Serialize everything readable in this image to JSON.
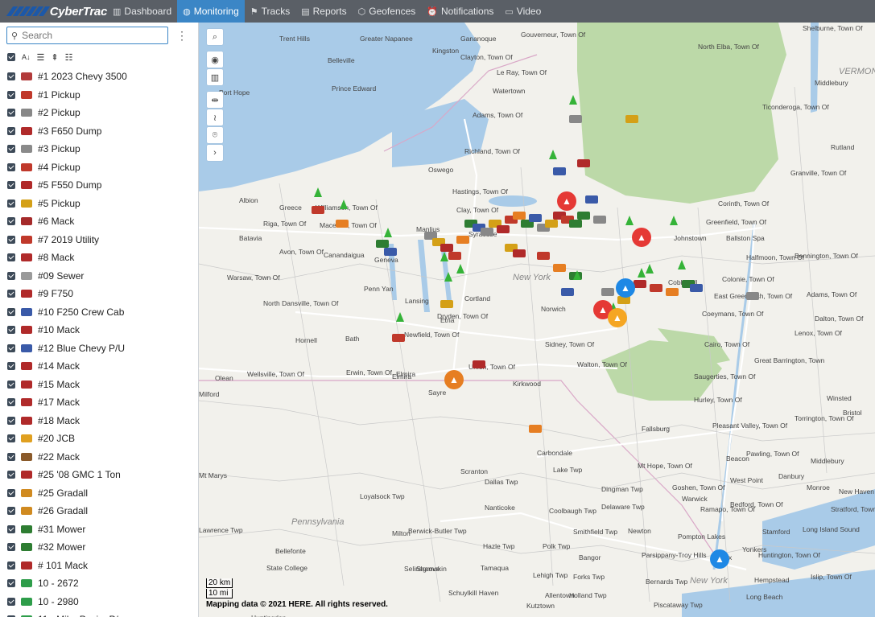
{
  "app": {
    "brand": "CyberTrac",
    "nav": [
      {
        "label": "Dashboard",
        "icon": "bar-chart-icon",
        "active": false
      },
      {
        "label": "Monitoring",
        "icon": "globe-icon",
        "active": true
      },
      {
        "label": "Tracks",
        "icon": "flag-icon",
        "active": false
      },
      {
        "label": "Reports",
        "icon": "report-icon",
        "active": false
      },
      {
        "label": "Geofences",
        "icon": "geofence-icon",
        "active": false
      },
      {
        "label": "Notifications",
        "icon": "alarm-clock-icon",
        "active": false
      },
      {
        "label": "Video",
        "icon": "video-icon",
        "active": false
      }
    ]
  },
  "sidebar": {
    "search_placeholder": "Search",
    "vehicles": [
      {
        "label": "#1 2023 Chevy 3500",
        "color": "#b23b3b"
      },
      {
        "label": "#1 Pickup",
        "color": "#c0392b"
      },
      {
        "label": "#2 Pickup",
        "color": "#888888"
      },
      {
        "label": "#3 F650 Dump",
        "color": "#b02a2a"
      },
      {
        "label": "#3 Pickup",
        "color": "#8a8a8a"
      },
      {
        "label": "#4 Pickup",
        "color": "#c0392b"
      },
      {
        "label": "#5 F550 Dump",
        "color": "#b02a2a"
      },
      {
        "label": "#5 Pickup",
        "color": "#d4a017"
      },
      {
        "label": "#6 Mack",
        "color": "#a52a2a"
      },
      {
        "label": "#7 2019 Utility",
        "color": "#c0392b"
      },
      {
        "label": "#8 Mack",
        "color": "#b02a2a"
      },
      {
        "label": "#09 Sewer",
        "color": "#9a9a9a"
      },
      {
        "label": "#9 F750",
        "color": "#b02a2a"
      },
      {
        "label": "#10 F250 Crew Cab",
        "color": "#3a5aa8"
      },
      {
        "label": "#10 Mack",
        "color": "#b02a2a"
      },
      {
        "label": "#12 Blue Chevy P/U",
        "color": "#3a5aa8"
      },
      {
        "label": "#14 Mack",
        "color": "#b02a2a"
      },
      {
        "label": "#15 Mack",
        "color": "#b02a2a"
      },
      {
        "label": "#17 Mack",
        "color": "#b02a2a"
      },
      {
        "label": "#18 Mack",
        "color": "#b02a2a"
      },
      {
        "label": "#20 JCB",
        "color": "#e0a020"
      },
      {
        "label": "#22 Mack",
        "color": "#8a5a2a"
      },
      {
        "label": "#25 '08 GMC 1 Ton",
        "color": "#b02a2a"
      },
      {
        "label": "#25 Gradall",
        "color": "#d08a20"
      },
      {
        "label": "#26 Gradall",
        "color": "#d08a20"
      },
      {
        "label": "#31 Mower",
        "color": "#2e7d32"
      },
      {
        "label": "#32 Mower",
        "color": "#2e7d32"
      },
      {
        "label": "# 101 Mack",
        "color": "#b02a2a"
      },
      {
        "label": "10 - 2672",
        "color": "#2e9d4a"
      },
      {
        "label": "10 - 2980",
        "color": "#2e9d4a"
      },
      {
        "label": "11 - Mike Pesi... P/u",
        "color": "#2e9d4a"
      }
    ]
  },
  "map": {
    "scale_km": "20 km",
    "scale_mi": "10 mi",
    "credit": "Mapping data © 2021 HERE. All rights reserved.",
    "labels": [
      "Trent Hills",
      "Greater Napanee",
      "Gananoque",
      "Gouverneur, Town Of",
      "Shelburne, Town Of",
      "North Elba, Town Of",
      "Kingston",
      "Clayton, Town Of",
      "Belleville",
      "Middlebury",
      "VERMONT",
      "Le Ray, Town Of",
      "Prince Edward",
      "Port Hope",
      "Watertown",
      "Ticonderoga, Town Of",
      "Adams, Town Of",
      "Richland, Town Of",
      "Rutland",
      "Oswego",
      "Granville, Town Of",
      "Hastings, Town Of",
      "Albion",
      "Williamson, Town Of",
      "Clay, Town Of",
      "Corinth, Town Of",
      "Riga, Town Of",
      "Macedon, Town Of",
      "Greenfield, Town Of",
      "Batavia",
      "Syracuse",
      "Johnstown",
      "Ballston Spa",
      "Avon, Town Of",
      "Canandaigua",
      "Geneva",
      "Halfmoon, Town Of",
      "Bennington, Town Of",
      "Warsaw, Town Of",
      "New York",
      "Cobleskill",
      "Colonie, Town Of",
      "Penn Yan",
      "North Dansville, Town Of",
      "Lansing",
      "Cortland",
      "Norwich",
      "East Greenbush, Town Of",
      "Adams, Town Of",
      "Coeymans, Town Of",
      "Dryden, Town Of",
      "Dalton, Town Of",
      "Hornell",
      "Bath",
      "Newfield, Town Of",
      "Lenox, Town Of",
      "Sidney, Town Of",
      "Cairo, Town Of",
      "Erwin, Town Of",
      "Elmira",
      "Union, Town Of",
      "Walton, Town Of",
      "Great Barrington, Town",
      "Olean",
      "Wellsville, Town Of",
      "Saugerties, Town Of",
      "Sayre",
      "Kirkwood",
      "Hurley, Town Of",
      "Winsted",
      "Pleasant Valley, Town Of",
      "Torrington, Town Of",
      "Bristol",
      "Fallsburg",
      "Carbondale",
      "Pawling, Town Of",
      "Middlebury",
      "Scranton",
      "Mt Hope, Town Of",
      "Beacon",
      "Lake Twp",
      "Dallas Twp",
      "Dingman Twp",
      "Goshen, Town Of",
      "West Point",
      "Danbury",
      "Monroe",
      "New Haven",
      "Loyalsock Twp",
      "Delaware Twp",
      "Warwick",
      "Bedford, Town Of",
      "Stratford, Town Of",
      "Nanticoke",
      "Coolbaugh Twp",
      "Ramapo, Town Of",
      "Pennsylvania",
      "Berwick-Butler Twp",
      "Smithfield Twp",
      "Newton",
      "Stamford",
      "Long Island Sound",
      "Milton",
      "Pompton Lakes",
      "Yonkers",
      "Hazle Twp",
      "Polk Twp",
      "Bangor",
      "Parsippany-Troy Hills",
      "Huntington, Town Of",
      "Bellefonte",
      "State College",
      "Tamaqua",
      "Lehigh Twp",
      "Forks Twp",
      "Selinsgrove",
      "Shamokin",
      "Bronx",
      "New York",
      "Hempstead",
      "Islip, Town Of",
      "Schuylkill Haven",
      "Allentown",
      "Holland Twp",
      "Bernards Twp",
      "Kutztown",
      "Piscataway Twp",
      "Long Beach",
      "Lawrence Twp",
      "Huntingdon",
      "Mt Marys",
      "Milford",
      "Greece",
      "Manlius",
      "Elmira",
      "Etna"
    ]
  }
}
